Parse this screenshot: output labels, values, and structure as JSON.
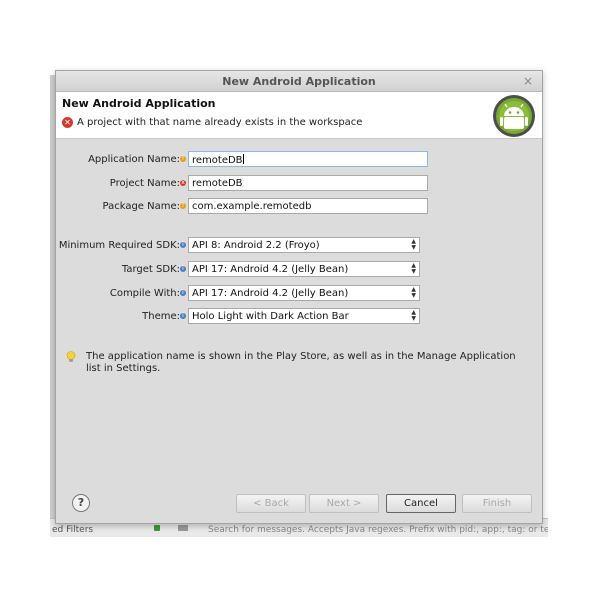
{
  "background": {
    "bottom_left_text": "ed Filters",
    "bottom_right_text": "Search for messages. Accepts Java regexes. Prefix with pid:, app:, tag: or text: to"
  },
  "dialog": {
    "window_title": "New Android Application",
    "close_glyph": "×",
    "header": {
      "title": "New Android Application",
      "error_message": "A project with that name already exists in the workspace"
    },
    "fields": {
      "application_name": {
        "label": "Application Name:",
        "value": "remoteDB"
      },
      "project_name": {
        "label": "Project Name:",
        "value": "remoteDB"
      },
      "package_name": {
        "label": "Package Name:",
        "value": "com.example.remotedb"
      }
    },
    "selects": {
      "min_sdk": {
        "label": "Minimum Required SDK:",
        "value": "API 8: Android 2.2 (Froyo)"
      },
      "target_sdk": {
        "label": "Target SDK:",
        "value": "API 17: Android 4.2 (Jelly Bean)"
      },
      "compile_with": {
        "label": "Compile With:",
        "value": "API 17: Android 4.2 (Jelly Bean)"
      },
      "theme": {
        "label": "Theme:",
        "value": "Holo Light with Dark Action Bar"
      }
    },
    "hint_text": "The application name is shown in the Play Store, as well as in the Manage Application list in Settings.",
    "buttons": {
      "help": "?",
      "back": "< Back",
      "next": "Next >",
      "cancel": "Cancel",
      "finish": "Finish"
    }
  },
  "colors": {
    "error": "#d03a2f",
    "warning": "#e3a21a",
    "info": "#4a7fc0",
    "android_green": "#a4c639"
  }
}
